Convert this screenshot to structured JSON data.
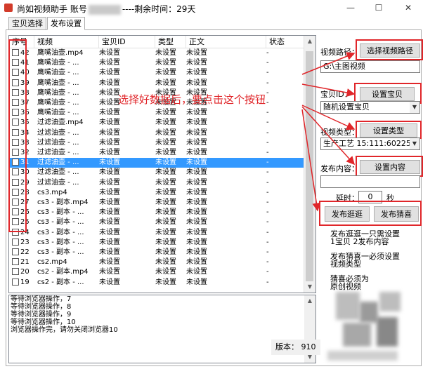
{
  "window": {
    "title_prefix": "尚如视频助手 账号",
    "title_suffix": "----剩余时间：29天",
    "minimize": "—",
    "maximize": "☐",
    "close": "✕"
  },
  "tabs": [
    {
      "label": "宝贝选择"
    },
    {
      "label": "发布设置"
    }
  ],
  "grid": {
    "columns": [
      "序号",
      "视频",
      "宝贝ID",
      "类型",
      "正文",
      "状态"
    ],
    "rows": [
      {
        "no": "42",
        "video": "鹰嘴油壶.mp4",
        "id": "未设置",
        "type": "未设置",
        "body": "未设置",
        "status": "-"
      },
      {
        "no": "41",
        "video": "鹰嘴油壶 - ...",
        "id": "未设置",
        "type": "未设置",
        "body": "未设置",
        "status": "-"
      },
      {
        "no": "40",
        "video": "鹰嘴油壶 - ...",
        "id": "未设置",
        "type": "未设置",
        "body": "未设置",
        "status": "-"
      },
      {
        "no": "39",
        "video": "鹰嘴油壶 - ...",
        "id": "未设置",
        "type": "未设置",
        "body": "未设置",
        "status": "-"
      },
      {
        "no": "38",
        "video": "鹰嘴油壶 - ...",
        "id": "未设置",
        "type": "未设置",
        "body": "未设置",
        "status": "-"
      },
      {
        "no": "37",
        "video": "鹰嘴油壶 - ...",
        "id": "未设置",
        "type": "未设置",
        "body": "未设置",
        "status": "-"
      },
      {
        "no": "36",
        "video": "鹰嘴油壶 - ...",
        "id": "未设置",
        "type": "未设置",
        "body": "未设置",
        "status": "-"
      },
      {
        "no": "35",
        "video": "过滤油壶.mp4",
        "id": "未设置",
        "type": "未设置",
        "body": "未设置",
        "status": "-"
      },
      {
        "no": "34",
        "video": "过滤油壶 - ...",
        "id": "未设置",
        "type": "未设置",
        "body": "未设置",
        "status": "-"
      },
      {
        "no": "33",
        "video": "过滤油壶 - ...",
        "id": "未设置",
        "type": "未设置",
        "body": "未设置",
        "status": "-"
      },
      {
        "no": "32",
        "video": "过滤油壶 - ...",
        "id": "未设置",
        "type": "未设置",
        "body": "未设置",
        "status": "-"
      },
      {
        "no": "31",
        "video": "过滤油壶 - ...",
        "id": "未设置",
        "type": "未设置",
        "body": "未设置",
        "status": "-",
        "selected": true
      },
      {
        "no": "30",
        "video": "过滤油壶 - ...",
        "id": "未设置",
        "type": "未设置",
        "body": "未设置",
        "status": "-"
      },
      {
        "no": "29",
        "video": "过滤油壶 - ...",
        "id": "未设置",
        "type": "未设置",
        "body": "未设置",
        "status": "-"
      },
      {
        "no": "28",
        "video": "cs3.mp4",
        "id": "未设置",
        "type": "未设置",
        "body": "未设置",
        "status": "-"
      },
      {
        "no": "27",
        "video": "cs3 - 副本.mp4",
        "id": "未设置",
        "type": "未设置",
        "body": "未设置",
        "status": "-"
      },
      {
        "no": "26",
        "video": "cs3 - 副本 - ...",
        "id": "未设置",
        "type": "未设置",
        "body": "未设置",
        "status": "-"
      },
      {
        "no": "25",
        "video": "cs3 - 副本 - ...",
        "id": "未设置",
        "type": "未设置",
        "body": "未设置",
        "status": "-"
      },
      {
        "no": "24",
        "video": "cs3 - 副本 - ...",
        "id": "未设置",
        "type": "未设置",
        "body": "未设置",
        "status": "-"
      },
      {
        "no": "23",
        "video": "cs3 - 副本 - ...",
        "id": "未设置",
        "type": "未设置",
        "body": "未设置",
        "status": "-"
      },
      {
        "no": "22",
        "video": "cs3 - 副本 - ...",
        "id": "未设置",
        "type": "未设置",
        "body": "未设置",
        "status": "-"
      },
      {
        "no": "21",
        "video": "cs2.mp4",
        "id": "未设置",
        "type": "未设置",
        "body": "未设置",
        "status": "-"
      },
      {
        "no": "20",
        "video": "cs2 - 副本.mp4",
        "id": "未设置",
        "type": "未设置",
        "body": "未设置",
        "status": "-"
      },
      {
        "no": "19",
        "video": "cs2 - 副本 - ...",
        "id": "未设置",
        "type": "未设置",
        "body": "未设置",
        "status": "-"
      }
    ]
  },
  "log": {
    "lines": [
      "等待浏览器操作，7",
      "等待浏览器操作，8",
      "等待浏览器操作，9",
      "等待浏览器操作，10",
      "浏览器操作完，请勿关闭浏览器10"
    ]
  },
  "right": {
    "video_path_label": "视频路径：",
    "choose_path_button": "选择视频路径",
    "video_path_value": "G:\\主图视频",
    "baobei_label": "宝贝ID：",
    "set_baobei_button": "设置宝贝",
    "baobei_combo": "随机设置宝贝",
    "video_type_label": "视频类型：",
    "set_type_button": "设置类型",
    "type_combo": "生产工艺 15:111:60225",
    "content_label": "发布内容：",
    "set_content_button": "设置内容",
    "content_value": "",
    "delay_label": "延时：",
    "delay_value": "0",
    "delay_unit": "秒",
    "publish_guangguang_button": "发布逛逛",
    "publish_caixi_button": "发布猜喜",
    "note1_line1": "发布逛逛一只需设置",
    "note1_line2": "1宝贝 2发布内容",
    "note2_line1": "发布猜喜一必须设置",
    "note2_line2": "视频类型",
    "note3_line1": "猜喜必须为",
    "note3_line2": "原创视频",
    "version_label": "版本：",
    "version_value": "910"
  },
  "annotation": {
    "text": "选择好数据后，要点击这个按钮",
    "color": "#e0262a"
  }
}
